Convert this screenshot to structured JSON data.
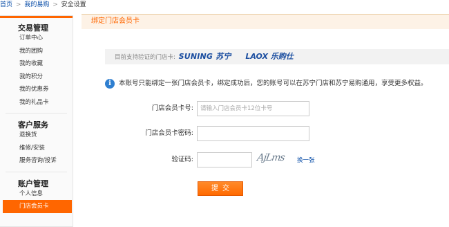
{
  "breadcrumb": {
    "home": "首页",
    "my_suning": "我的易购",
    "current": "安全设置",
    "sep": ">"
  },
  "sidebar": {
    "sections": [
      {
        "title": "交易管理",
        "items": [
          "订单中心",
          "我的团购",
          "我的收藏",
          "我的积分",
          "我的优惠券",
          "我的礼品卡"
        ]
      },
      {
        "title": "客户服务",
        "items": [
          "退换货",
          "维修/安装",
          "服务咨询/投诉"
        ]
      },
      {
        "title": "账户管理",
        "items": [
          "个人信息",
          "门店会员卡"
        ]
      }
    ],
    "active_item": "门店会员卡"
  },
  "panel": {
    "title": "绑定门店会员卡",
    "store_bar": {
      "label": "目前支持验证的门店卡:",
      "logo_suning": "SUNING 苏宁",
      "logo_laox": "LAOX 乐购仕"
    },
    "info_text": "本账号只能绑定一张门店会员卡，绑定成功后，您的账号可以在苏宁门店和苏宁易购通用，享受更多权益。",
    "form": {
      "card_label": "门店会员卡号:",
      "card_placeholder": "请输入门店会员卡12位卡号",
      "card_value": "",
      "password_label": "门店会员卡密码:",
      "password_value": "",
      "captcha_label": "验证码:",
      "captcha_value": "",
      "captcha_image_text": "AjLms",
      "refresh_label": "换一张",
      "submit_label": "提交"
    }
  },
  "colors": {
    "accent": "#ff6600",
    "link": "#0a4ea8",
    "info_icon": "#2f7fd0"
  }
}
